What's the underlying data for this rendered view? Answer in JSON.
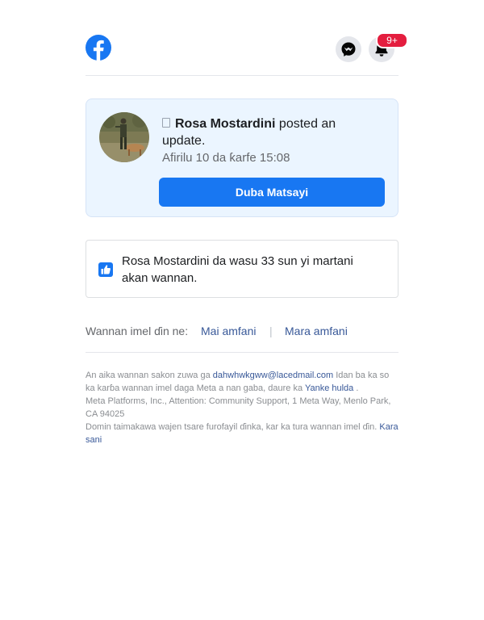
{
  "header": {
    "logo_icon": "facebook-logo",
    "messenger_icon": "messenger-icon",
    "bell_icon": "bell-icon",
    "badge": "9+"
  },
  "card": {
    "name": "Rosa Mostardini",
    "action": "posted an update.",
    "time": "Afirilu 10 da ƙarfe 15:08",
    "button": "Duba Matsayi"
  },
  "likes": {
    "text": "Rosa Mostardini da wasu 33 sun yi martani akan wannan."
  },
  "feedback": {
    "question": "Wannan imel ɗin ne:",
    "yes": "Mai amfani",
    "sep": "|",
    "no": "Mara amfani"
  },
  "footer": {
    "line1_pre": "An aika wannan sakon zuwa ga",
    "email": "dahwhwkgww@lacedmail.com",
    "line1_post": "Idan ba ka so ka karɓa wannan imel daga Meta a nan gaba, daure ka",
    "unsubscribe": "Yanke hulda",
    "dot": ".",
    "address": "Meta Platforms, Inc., Attention: Community Support, 1 Meta Way, Menlo Park, CA 94025",
    "security": "Domin taimakawa wajen tsare furofayil ɗinka, kar ka tura wannan imel ɗin.",
    "learn_more": "Kara sani"
  },
  "colors": {
    "brand": "#1877f2",
    "badge": "#e41e3f",
    "card_bg": "#ebf5ff"
  }
}
